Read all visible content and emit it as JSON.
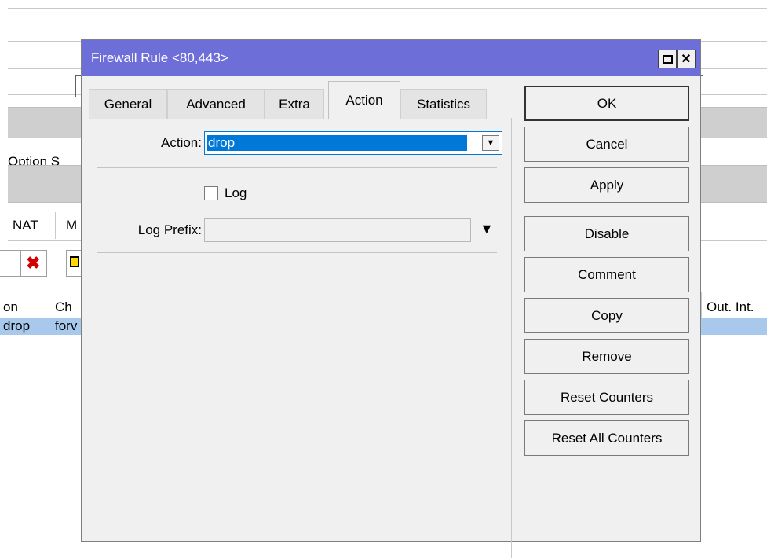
{
  "background": {
    "text_option": "Option S",
    "tabs": [
      "NAT",
      "M"
    ],
    "column_headers": [
      "on",
      "Ch",
      "Out. Int."
    ],
    "row": [
      "drop",
      "forv"
    ]
  },
  "dialog": {
    "title": "Firewall Rule <80,443>",
    "tabs": [
      "General",
      "Advanced",
      "Extra",
      "Action",
      "Statistics"
    ],
    "active_tab": "Action",
    "fields": {
      "action_label": "Action:",
      "action_value": "drop",
      "log_label": "Log",
      "log_checked": false,
      "log_prefix_label": "Log Prefix:",
      "log_prefix_value": ""
    },
    "buttons": {
      "ok": "OK",
      "cancel": "Cancel",
      "apply": "Apply",
      "disable": "Disable",
      "comment": "Comment",
      "copy": "Copy",
      "remove": "Remove",
      "reset_counters": "Reset Counters",
      "reset_all_counters": "Reset All Counters"
    },
    "colors": {
      "titlebar": "#6d6ed8",
      "selection": "#0078d7",
      "row_highlight": "#a8c8ec"
    },
    "icons": [
      "maximize-icon",
      "close-icon",
      "dropdown-icon",
      "delete-icon"
    ]
  }
}
